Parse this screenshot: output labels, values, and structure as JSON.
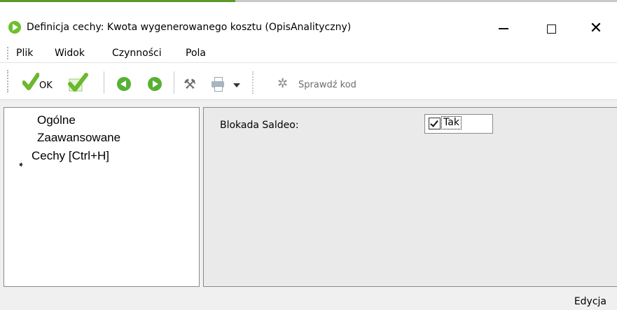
{
  "window": {
    "title": "Definicja cechy: Kwota wygenerowanego kosztu (OpisAnalityczny)",
    "accent_color": "#5a9a2a",
    "icon": "app-play-icon"
  },
  "menu": {
    "items": [
      "Plik",
      "Widok",
      "Czynności",
      "Pola"
    ]
  },
  "toolbar": {
    "ok_label": "OK",
    "verify_label": "Sprawdź kod",
    "icons": [
      "ok-check-icon",
      "apply-check-icon",
      "back-arrow-icon",
      "forward-arrow-icon",
      "tools-icon",
      "print-icon",
      "dropdown-icon",
      "wand-icon"
    ]
  },
  "tree": {
    "items": [
      "Ogólne",
      "Zaawansowane",
      "Cechy [Ctrl+H]"
    ],
    "selected_index": 2
  },
  "properties": {
    "blokada_label": "Blokada Saldeo:",
    "blokada_checked": true,
    "blokada_value": "Tak"
  },
  "status": {
    "mode": "Edycja"
  }
}
